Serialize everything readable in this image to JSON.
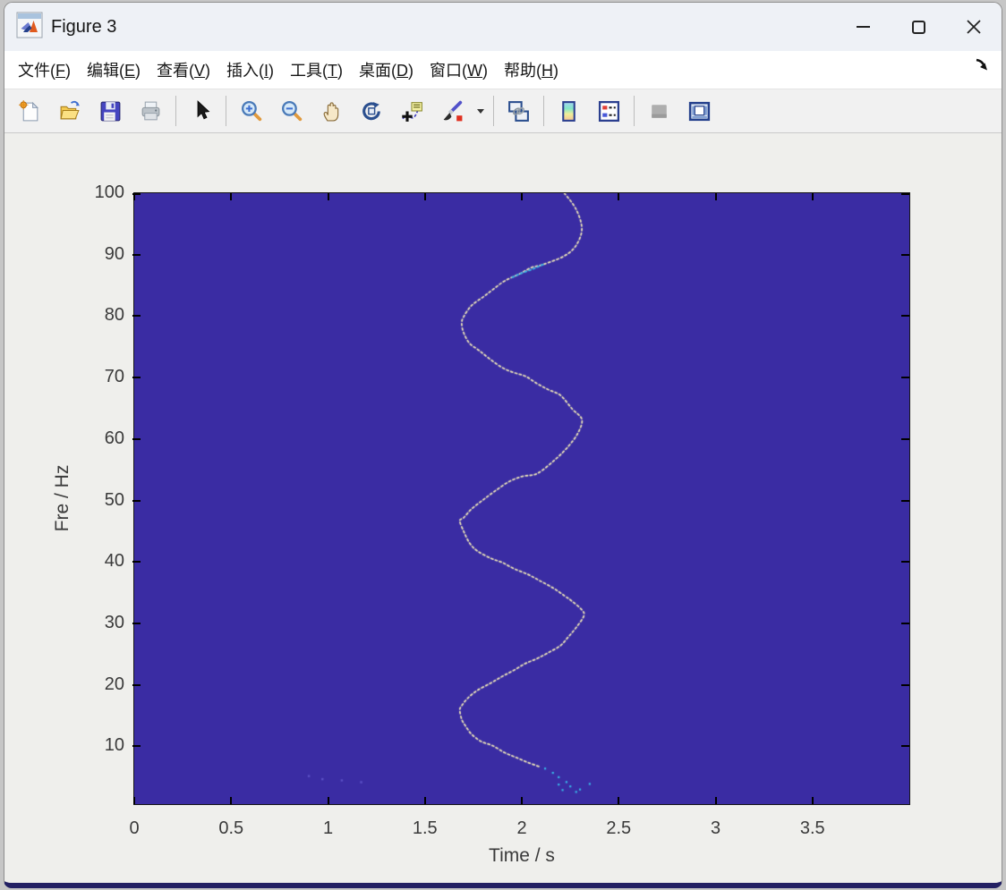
{
  "window": {
    "title": "Figure 3",
    "controls": [
      "minimize",
      "maximize",
      "close"
    ]
  },
  "menu": {
    "items": [
      {
        "name": "file",
        "pre": "文件(",
        "key": "F",
        "post": ")"
      },
      {
        "name": "edit",
        "pre": "编辑(",
        "key": "E",
        "post": ")"
      },
      {
        "name": "view",
        "pre": "查看(",
        "key": "V",
        "post": ")"
      },
      {
        "name": "insert",
        "pre": "插入(",
        "key": "I",
        "post": ")"
      },
      {
        "name": "tools",
        "pre": "工具(",
        "key": "T",
        "post": ")"
      },
      {
        "name": "desktop",
        "pre": "桌面(",
        "key": "D",
        "post": ")"
      },
      {
        "name": "window",
        "pre": "窗口(",
        "key": "W",
        "post": ")"
      },
      {
        "name": "help",
        "pre": "帮助(",
        "key": "H",
        "post": ")"
      }
    ]
  },
  "toolbar": {
    "icons": [
      "new-figure",
      "open-file",
      "save-figure",
      "print-figure",
      "edit-plot-cursor",
      "zoom-in",
      "zoom-out",
      "pan-hand",
      "rotate-3d",
      "data-cursor",
      "brush-data",
      "brush-options-caret",
      "link-plot",
      "insert-colorbar",
      "insert-legend",
      "hide-plot-tools",
      "show-plot-tools-dock"
    ]
  },
  "chart_data": {
    "type": "heatmap",
    "subtype": "spectrogram",
    "title": "",
    "xlabel": "Time / s",
    "ylabel": "Fre / Hz",
    "xlim": [
      0,
      4
    ],
    "ylim": [
      0.6,
      100
    ],
    "grid": false,
    "background_value_color": "#3a2ca3",
    "ridge_color": "#ece4b8",
    "cyan_color": "#38b6e8",
    "speck_color": "#5a50c4",
    "x_ticks": {
      "values": [
        0,
        0.5,
        1,
        1.5,
        2,
        2.5,
        3,
        3.5
      ],
      "labels": [
        "0",
        "0.5",
        "1",
        "1.5",
        "2",
        "2.5",
        "3",
        "3.5"
      ]
    },
    "y_ticks": {
      "values": [
        10,
        20,
        30,
        40,
        50,
        60,
        70,
        80,
        90,
        100
      ],
      "labels": [
        "10",
        "20",
        "30",
        "40",
        "50",
        "60",
        "70",
        "80",
        "90",
        "100"
      ]
    },
    "ridge_description": "bright dotted spectral ridge oscillating about t=2.0 s, amplitude ~0.31 s, period ~31 Hz, from 100 Hz down to ~3 Hz",
    "ridge_points": [
      [
        2.22,
        100
      ],
      [
        2.28,
        97.4
      ],
      [
        2.31,
        94.2
      ],
      [
        2.28,
        91.5
      ],
      [
        2.22,
        89.8
      ],
      [
        2.11,
        88.4
      ],
      [
        2.05,
        87.9
      ],
      [
        1.99,
        86.9
      ],
      [
        1.91,
        85.7
      ],
      [
        1.85,
        84.3
      ],
      [
        1.8,
        83.1
      ],
      [
        1.74,
        81.7
      ],
      [
        1.7,
        79.9
      ],
      [
        1.69,
        78.8
      ],
      [
        1.7,
        77.3
      ],
      [
        1.73,
        75.6
      ],
      [
        1.78,
        74.4
      ],
      [
        1.84,
        72.9
      ],
      [
        1.9,
        71.6
      ],
      [
        1.96,
        70.8
      ],
      [
        2.02,
        70.2
      ],
      [
        2.08,
        69.0
      ],
      [
        2.14,
        68.0
      ],
      [
        2.2,
        67.1
      ],
      [
        2.26,
        64.9
      ],
      [
        2.31,
        63.2
      ],
      [
        2.29,
        61.0
      ],
      [
        2.24,
        58.8
      ],
      [
        2.17,
        56.6
      ],
      [
        2.08,
        54.4
      ],
      [
        2.0,
        53.9
      ],
      [
        1.93,
        53.0
      ],
      [
        1.86,
        51.5
      ],
      [
        1.8,
        50.1
      ],
      [
        1.74,
        48.6
      ],
      [
        1.7,
        47.2
      ],
      [
        1.68,
        46.7
      ],
      [
        1.7,
        45.0
      ],
      [
        1.73,
        43.1
      ],
      [
        1.77,
        41.8
      ],
      [
        1.84,
        40.6
      ],
      [
        1.9,
        39.9
      ],
      [
        1.96,
        38.9
      ],
      [
        2.03,
        38.0
      ],
      [
        2.09,
        37.0
      ],
      [
        2.16,
        35.8
      ],
      [
        2.22,
        34.5
      ],
      [
        2.26,
        33.6
      ],
      [
        2.31,
        32.2
      ],
      [
        2.32,
        31.2
      ],
      [
        2.28,
        29.3
      ],
      [
        2.24,
        27.8
      ],
      [
        2.2,
        26.4
      ],
      [
        2.14,
        25.3
      ],
      [
        2.08,
        24.3
      ],
      [
        2.02,
        23.5
      ],
      [
        1.96,
        22.4
      ],
      [
        1.9,
        21.4
      ],
      [
        1.84,
        20.3
      ],
      [
        1.77,
        19.1
      ],
      [
        1.72,
        17.8
      ],
      [
        1.69,
        16.6
      ],
      [
        1.68,
        15.9
      ],
      [
        1.69,
        14.4
      ],
      [
        1.71,
        13.3
      ],
      [
        1.74,
        12.0
      ],
      [
        1.79,
        10.8
      ],
      [
        1.85,
        10.1
      ],
      [
        1.91,
        9.0
      ],
      [
        1.97,
        8.2
      ],
      [
        2.03,
        7.4
      ],
      [
        2.09,
        6.7
      ]
    ],
    "cyan_points_upper": [
      [
        2.11,
        88.4
      ],
      [
        2.06,
        87.7
      ],
      [
        2.0,
        87.0
      ],
      [
        1.95,
        86.3
      ]
    ],
    "cyan_tail_points": [
      [
        2.12,
        6.4
      ],
      [
        2.16,
        5.7
      ],
      [
        2.19,
        5.0
      ],
      [
        2.23,
        4.2
      ],
      [
        2.25,
        3.5
      ],
      [
        2.3,
        3.0
      ],
      [
        2.35,
        3.9
      ],
      [
        2.19,
        3.8
      ],
      [
        2.28,
        2.6
      ],
      [
        2.21,
        2.9
      ]
    ],
    "noise_specks": [
      [
        0.9,
        5.2
      ],
      [
        0.97,
        4.7
      ],
      [
        1.07,
        4.5
      ],
      [
        1.17,
        4.2
      ]
    ]
  }
}
